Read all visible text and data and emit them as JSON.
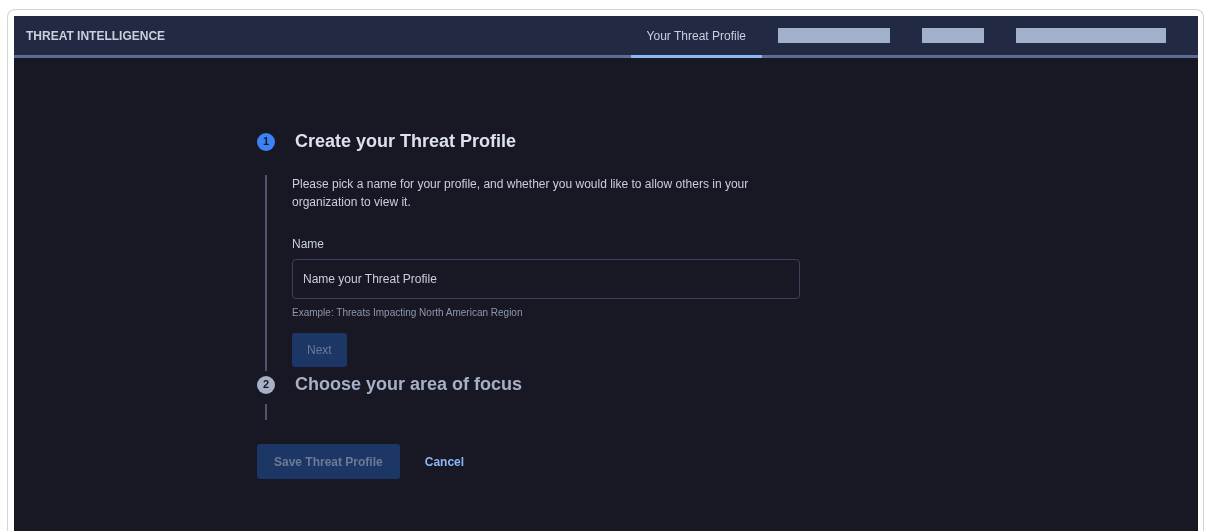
{
  "header": {
    "title": "THREAT INTELLIGENCE",
    "tabs": [
      {
        "kind": "label",
        "label": "Your Threat Profile",
        "selected": true
      },
      {
        "kind": "redacted",
        "selected": false
      },
      {
        "kind": "redacted",
        "selected": false
      },
      {
        "kind": "redacted",
        "selected": false
      }
    ]
  },
  "steps": [
    {
      "number": "1",
      "title": "Create your Threat Profile",
      "active": true,
      "description": "Please pick a name for your profile, and whether you would like to allow others in your organization to view it.",
      "field": {
        "label": "Name",
        "placeholder": "Name your Threat Profile",
        "hint": "Example: Threats Impacting North American Region"
      },
      "next_button": {
        "label": "Next",
        "disabled": true
      }
    },
    {
      "number": "2",
      "title": "Choose your area of focus",
      "active": false
    }
  ],
  "actions": [
    {
      "kind": "primary",
      "label": "Save Threat Profile",
      "disabled": true
    },
    {
      "kind": "link",
      "label": "Cancel",
      "disabled": false
    }
  ]
}
